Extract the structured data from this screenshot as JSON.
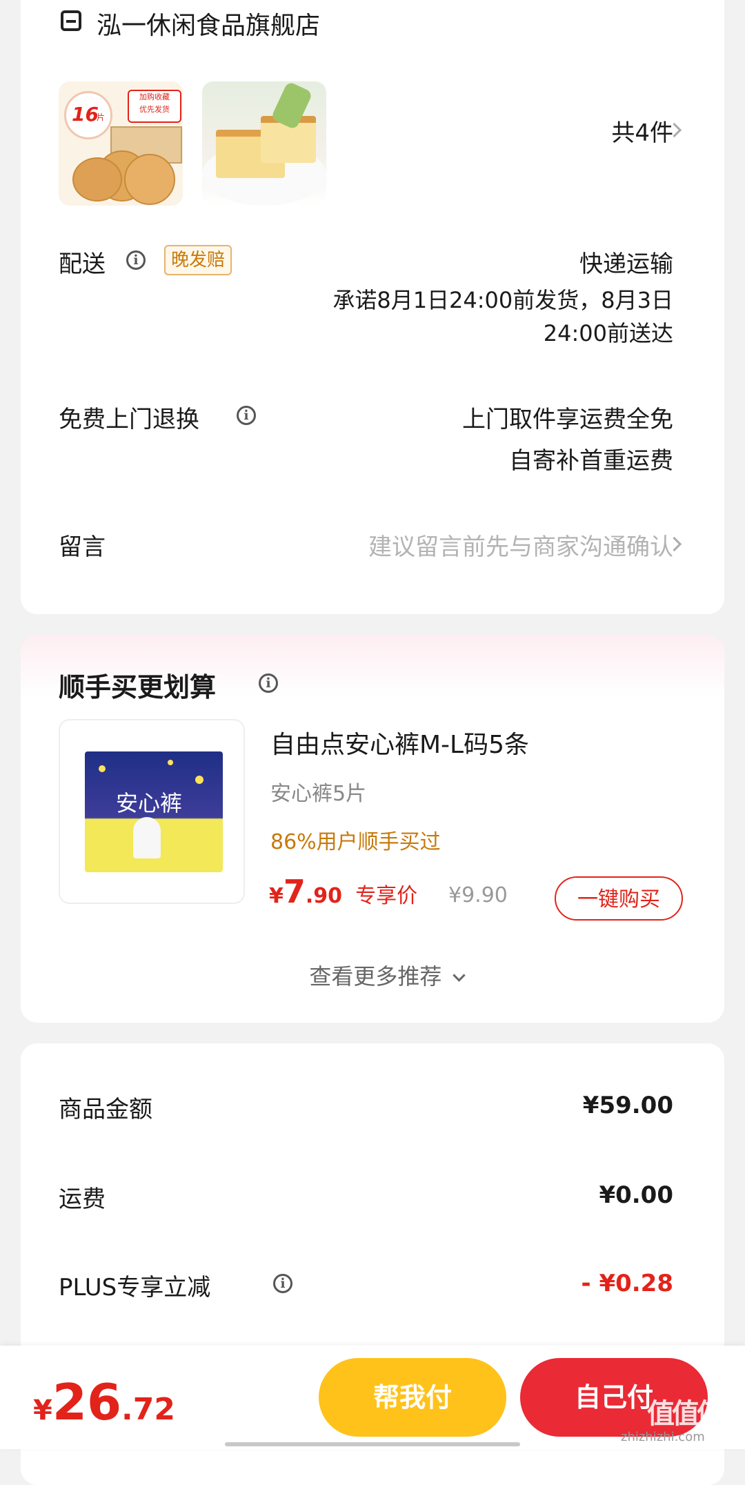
{
  "store": {
    "name": "泓一休闲食品旗舰店",
    "item_count": "共4件"
  },
  "product_thumbs": [
    {
      "badge_num": "16",
      "badge_unit": "片",
      "tag_line1": "加购收藏",
      "tag_line2": "优先发货"
    },
    {
      "name": "cake"
    }
  ],
  "delivery": {
    "label": "配送",
    "badge": "晚发赔",
    "method": "快递运输",
    "promise_line1": "承诺8月1日24:00前发货，8月3日",
    "promise_line2": "24:00前送达"
  },
  "returns": {
    "label": "免费上门退换",
    "line1": "上门取件享运费全免",
    "line2": "自寄补首重运费"
  },
  "message": {
    "label": "留言",
    "placeholder": "建议留言前先与商家沟通确认"
  },
  "upsell": {
    "title": "顺手买更划算",
    "product_name": "自由点安心裤M-L码5条",
    "spec": "安心裤5片",
    "social": "86%用户顺手买过",
    "price_symbol": "¥",
    "price_int": "7",
    "price_dec": ".90",
    "price_tag": "专享价",
    "orig_price": "¥9.90",
    "buy_button": "一键购买",
    "more": "查看更多推荐",
    "package_text": "安心裤"
  },
  "summary": {
    "rows": [
      {
        "label": "商品金额",
        "value": "¥59.00"
      },
      {
        "label": "运费",
        "value": "¥0.00"
      },
      {
        "label": "PLUS专享立减",
        "value": "- ¥0.28"
      }
    ]
  },
  "bottom_bar": {
    "currency": "¥",
    "total_int": "26",
    "total_dec": ".72",
    "help_pay": "帮我付",
    "self_pay": "自己付",
    "watermark": "值值值",
    "watermark_url": "zhizhizhi.com"
  },
  "colors": {
    "accent_red": "#e2231a",
    "orange_text": "#c8790b",
    "yellow_button": "#ffc21a",
    "badge_border": "#e6b36b"
  }
}
